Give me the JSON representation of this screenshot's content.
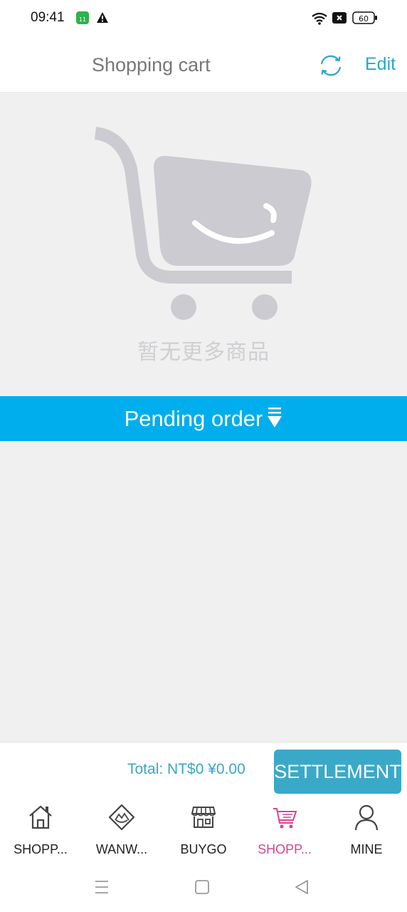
{
  "status": {
    "time": "09:41",
    "battery": "60"
  },
  "header": {
    "title": "Shopping cart",
    "edit_label": "Edit"
  },
  "empty": {
    "message": "暂无更多商品"
  },
  "pending": {
    "label": "Pending order"
  },
  "total": {
    "text": "Total:  NT$0  ¥0.00",
    "settlement_label": "SETTLEMENT"
  },
  "tabs": [
    {
      "label": "SHOPP...",
      "icon": "home-icon",
      "active": false
    },
    {
      "label": "WANW...",
      "icon": "diamond-icon",
      "active": false
    },
    {
      "label": "BUYGO",
      "icon": "store-icon",
      "active": false
    },
    {
      "label": "SHOPP...",
      "icon": "cart-icon",
      "active": true
    },
    {
      "label": "MINE",
      "icon": "user-icon",
      "active": false
    }
  ],
  "colors": {
    "accent": "#01aeed",
    "brand": "#3aa9c8",
    "active_tab": "#d4468d"
  }
}
